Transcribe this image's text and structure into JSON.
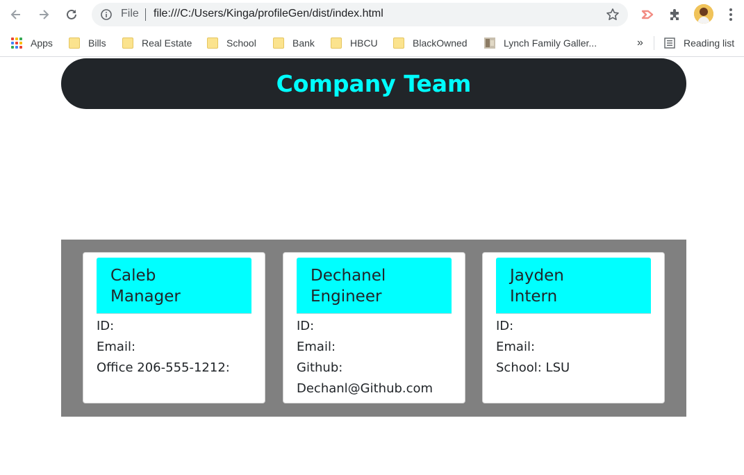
{
  "browser": {
    "address_scheme": "File",
    "url": "file:///C:/Users/Kinga/profileGen/dist/index.html",
    "bookmarks": [
      {
        "label": "Apps",
        "icon": "apps-grid-icon"
      },
      {
        "label": "Bills",
        "icon": "folder-icon"
      },
      {
        "label": "Real Estate",
        "icon": "folder-icon"
      },
      {
        "label": "School",
        "icon": "folder-icon"
      },
      {
        "label": "Bank",
        "icon": "folder-icon"
      },
      {
        "label": "HBCU",
        "icon": "folder-icon"
      },
      {
        "label": "BlackOwned",
        "icon": "folder-icon"
      },
      {
        "label": "Lynch Family Galler...",
        "icon": "gallery-thumbnail-icon"
      }
    ],
    "overflow_label": "»",
    "reading_list_label": "Reading list"
  },
  "page": {
    "title": "Company Team",
    "colors": {
      "header_bg": "#212529",
      "accent": "#00ffff",
      "section_bg": "#808080",
      "card_bg": "#ffffff"
    },
    "cards": [
      {
        "name": "Caleb",
        "role": "Manager",
        "fields": [
          "ID:",
          "Email:",
          "Office 206-555-1212:"
        ]
      },
      {
        "name": "Dechanel",
        "role": "Engineer",
        "fields": [
          "ID:",
          "Email:",
          "Github:",
          "Dechanl@Github.com"
        ]
      },
      {
        "name": "Jayden",
        "role": "Intern",
        "fields": [
          "ID:",
          "Email:",
          "School: LSU"
        ]
      }
    ]
  }
}
